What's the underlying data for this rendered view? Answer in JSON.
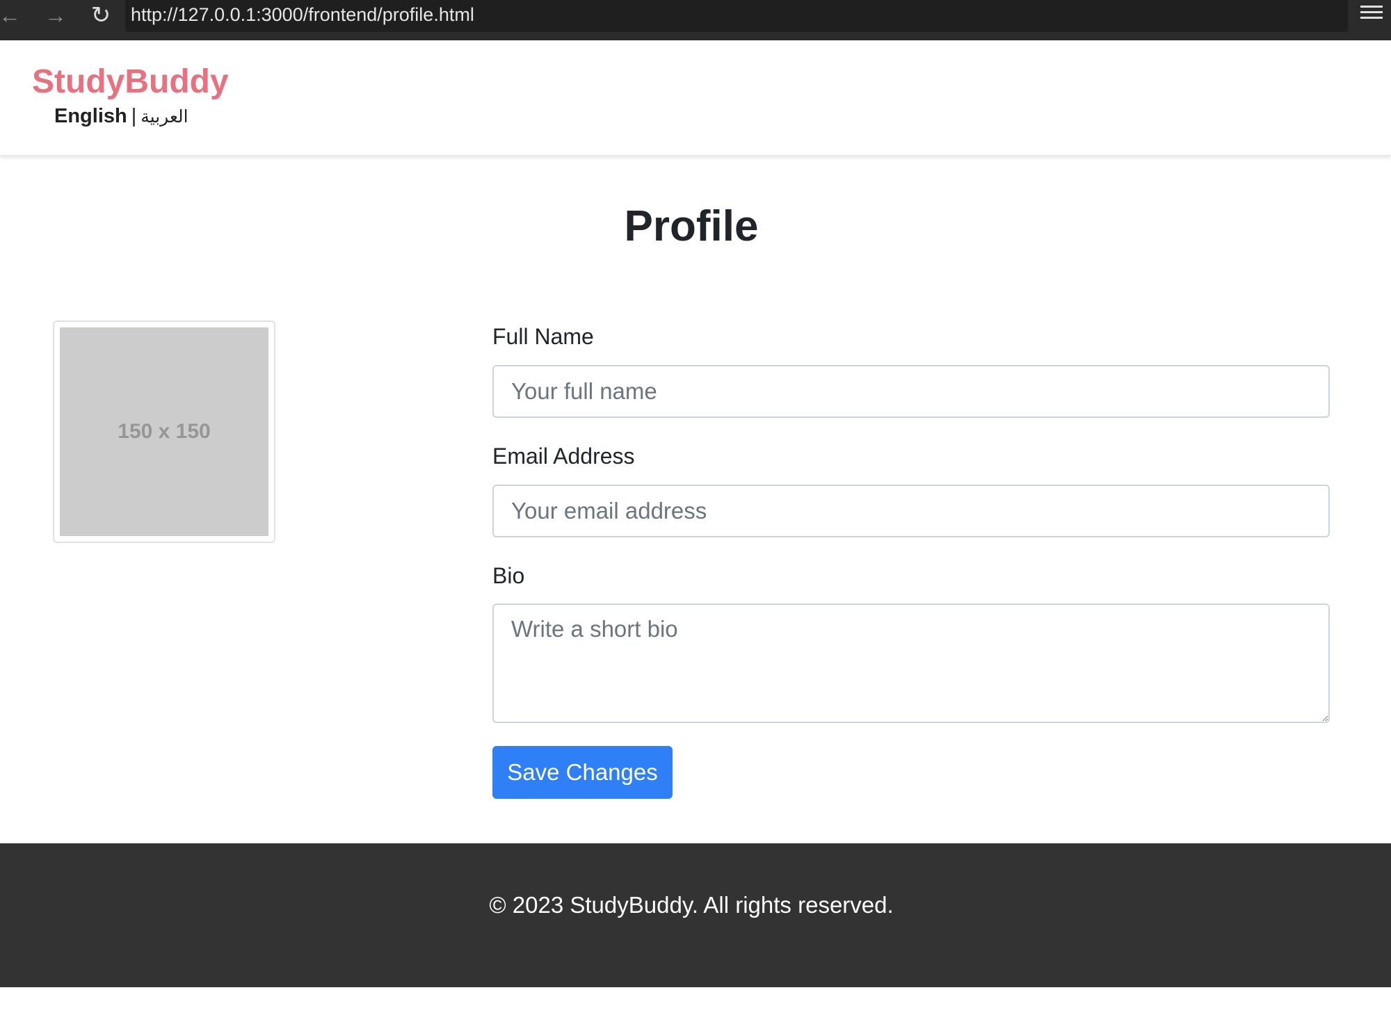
{
  "browser": {
    "back_glyph": "←",
    "forward_glyph": "→",
    "reload_glyph": "↻",
    "url": "http://127.0.0.1:3000/frontend/profile.html"
  },
  "header": {
    "brand": "StudyBuddy",
    "lang_english": "English",
    "lang_separator": "|",
    "lang_arabic": "العربية",
    "brand_color": "#e8707f"
  },
  "main": {
    "title": "Profile",
    "avatar_placeholder": "150 x 150",
    "form": {
      "full_name_label": "Full Name",
      "full_name_placeholder": "Your full name",
      "full_name_value": "",
      "email_label": "Email Address",
      "email_placeholder": "Your email address",
      "email_value": "",
      "bio_label": "Bio",
      "bio_placeholder": "Write a short bio",
      "bio_value": "",
      "save_label": "Save Changes",
      "save_color": "#2f7ff7"
    }
  },
  "footer": {
    "text": "© 2023 StudyBuddy. All rights reserved."
  }
}
